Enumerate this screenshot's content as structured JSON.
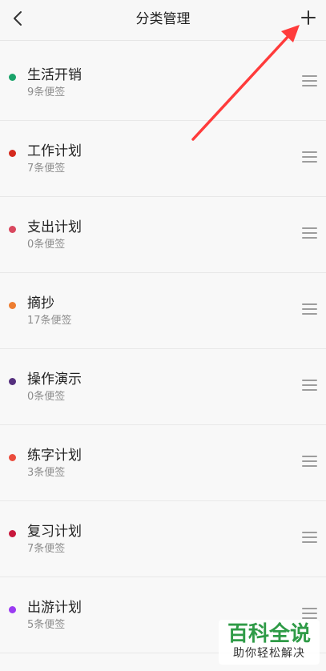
{
  "header": {
    "title": "分类管理",
    "back_icon": "chevron-left-icon",
    "add_icon": "plus-icon"
  },
  "categories": [
    {
      "name": "生活开销",
      "count": "9条便签",
      "color": "#1aa36a"
    },
    {
      "name": "工作计划",
      "count": "7条便签",
      "color": "#d52b1e"
    },
    {
      "name": "支出计划",
      "count": "0条便签",
      "color": "#d9485f"
    },
    {
      "name": "摘抄",
      "count": "17条便签",
      "color": "#ed7d31"
    },
    {
      "name": "操作演示",
      "count": "0条便签",
      "color": "#55307e"
    },
    {
      "name": "练字计划",
      "count": "3条便签",
      "color": "#eb4d3d"
    },
    {
      "name": "复习计划",
      "count": "7条便签",
      "color": "#c8193d"
    },
    {
      "name": "出游计划",
      "count": "5条便签",
      "color": "#9b3cf2"
    }
  ],
  "watermark": {
    "main": "百科全说",
    "sub": "助你轻松解决"
  },
  "annotation": {
    "arrow_color": "#ff3b3b"
  }
}
